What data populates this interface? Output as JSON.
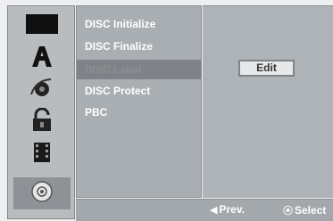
{
  "sidebar": {
    "icons": [
      {
        "name": "disc-black-icon"
      },
      {
        "name": "language-a-icon"
      },
      {
        "name": "audio-sound-icon"
      },
      {
        "name": "lock-icon"
      },
      {
        "name": "film-recording-icon"
      },
      {
        "name": "disc-selected-icon"
      }
    ]
  },
  "menu": {
    "items": [
      {
        "label": "DISC Initialize"
      },
      {
        "label": "DISC Finalize"
      },
      {
        "label": "DISC Label"
      },
      {
        "label": "DISC Protect"
      },
      {
        "label": "PBC"
      }
    ],
    "selected_index": 2
  },
  "right": {
    "edit_label": "Edit"
  },
  "footer": {
    "prev_label": "Prev.",
    "select_label": "Select"
  },
  "colors": {
    "panel": "#a9aeb3",
    "highlight": "#7f8388",
    "text": "#ffffff"
  }
}
